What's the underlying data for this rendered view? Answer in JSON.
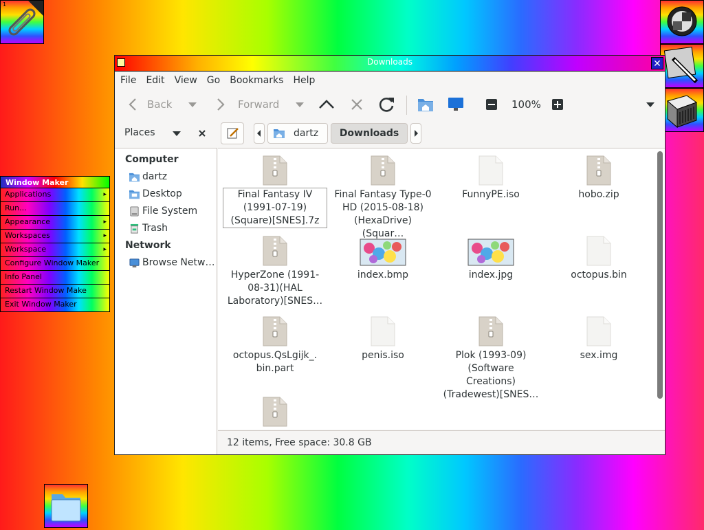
{
  "window": {
    "title": "Downloads",
    "close_glyph": "✕"
  },
  "menubar": [
    "File",
    "Edit",
    "View",
    "Go",
    "Bookmarks",
    "Help"
  ],
  "toolbar": {
    "back": "Back",
    "forward": "Forward",
    "zoom": "100%"
  },
  "sidebar_header": {
    "label": "Places"
  },
  "pathbar": {
    "crumbs": [
      "dartz",
      "Downloads"
    ]
  },
  "sidebar": {
    "computer_heading": "Computer",
    "computer_items": [
      "dartz",
      "Desktop",
      "File System",
      "Trash"
    ],
    "network_heading": "Network",
    "network_items": [
      "Browse Netw…"
    ]
  },
  "files": [
    {
      "name": "Final Fantasy IV (1991-07-19) (Square)[SNES].7z",
      "lines": [
        "Final Fantasy IV",
        "(1991-07-19)",
        "(Square)[SNES].7z"
      ],
      "type": "archive"
    },
    {
      "name": "Final Fantasy Type-0 HD",
      "lines": [
        "Final Fantasy Type-0",
        "HD (2015-08-18)",
        "(HexaDrive)(Squar…"
      ],
      "type": "archive"
    },
    {
      "name": "FunnyPE.iso",
      "lines": [
        "FunnyPE.iso"
      ],
      "type": "blank"
    },
    {
      "name": "hobo.zip",
      "lines": [
        "hobo.zip"
      ],
      "type": "archive"
    },
    {
      "name": "HyperZone",
      "lines": [
        "HyperZone (1991-",
        "08-31)(HAL",
        "Laboratory)[SNES…"
      ],
      "type": "archive"
    },
    {
      "name": "index.bmp",
      "lines": [
        "index.bmp"
      ],
      "type": "image"
    },
    {
      "name": "index.jpg",
      "lines": [
        "index.jpg"
      ],
      "type": "image"
    },
    {
      "name": "octopus.bin",
      "lines": [
        "octopus.bin"
      ],
      "type": "blank"
    },
    {
      "name": "octopus.QsLgijk_.bin.part",
      "lines": [
        "octopus.QsLgijk_.",
        "bin.part"
      ],
      "type": "archive"
    },
    {
      "name": "penis.iso",
      "lines": [
        "penis.iso"
      ],
      "type": "blank"
    },
    {
      "name": "Plok (1993-09)",
      "lines": [
        "Plok (1993-09)",
        "(Software Creations)",
        "(Tradewest)[SNES…"
      ],
      "type": "archive"
    },
    {
      "name": "sex.img",
      "lines": [
        "sex.img"
      ],
      "type": "blank"
    },
    {
      "name": "",
      "lines": [],
      "type": "archive"
    }
  ],
  "statusbar": {
    "text": "12 items, Free space: 30.8 GB"
  },
  "wm_menu": {
    "title": "Window Maker",
    "items": [
      {
        "label": "Applications",
        "submenu": true
      },
      {
        "label": "Run...",
        "submenu": false
      },
      {
        "label": "Appearance",
        "submenu": true
      },
      {
        "label": "Workspaces",
        "submenu": true
      },
      {
        "label": "Workspace",
        "submenu": true
      },
      {
        "label": "Configure Window Maker",
        "submenu": false
      },
      {
        "label": "Info Panel",
        "submenu": false
      },
      {
        "label": "Restart Window Make",
        "submenu": false
      },
      {
        "label": "Exit Window Maker",
        "submenu": false
      }
    ]
  },
  "clip": {
    "workspace_number": "1"
  },
  "icons": {
    "dock": [
      "clip-paperclip-icon",
      "preferences-icon",
      "wmaker-settings-brush-icon",
      "terminal-cube-icon"
    ],
    "dock_bottom": "folder-icon"
  }
}
